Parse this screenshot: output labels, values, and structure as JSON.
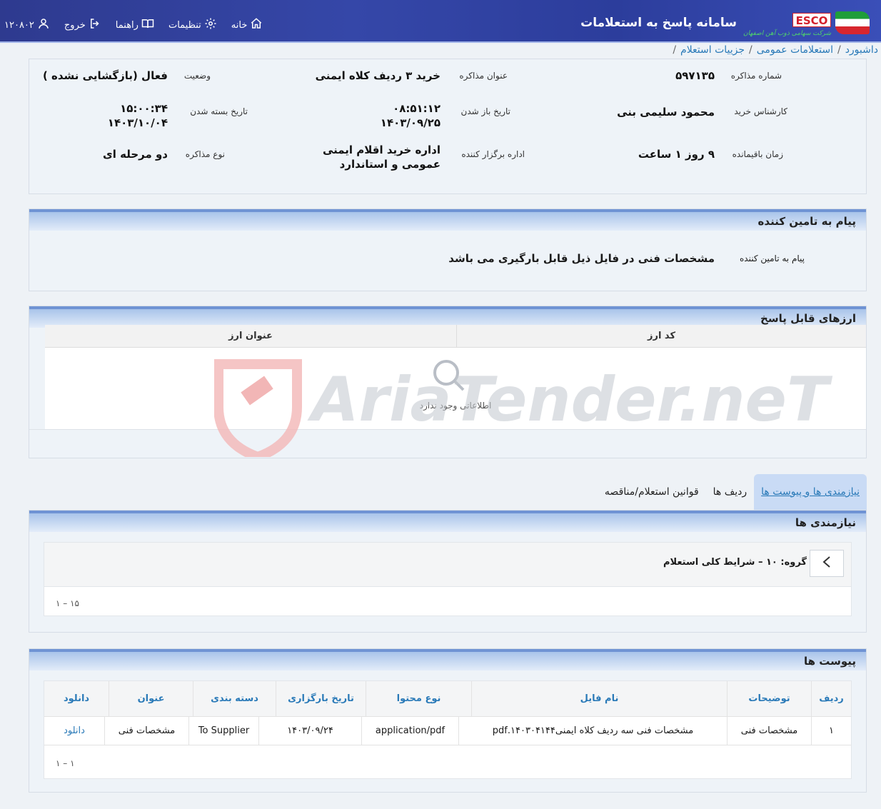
{
  "header": {
    "app_title": "سامانه پاسخ به استعلامات",
    "logo_text": "ESCO",
    "logo_sub": "شرکت سهامی ذوب آهن اصفهان",
    "nav": {
      "home": "خانه",
      "settings": "تنظیمات",
      "guide": "راهنما",
      "logout": "خروج",
      "user_id": "۱۲۰۸۰۲"
    }
  },
  "breadcrumb": [
    "داشبورد",
    "استعلامات عمومی",
    "جزییات استعلام"
  ],
  "info": {
    "negotiation_no_label": "شماره مذاکره",
    "negotiation_no": "۵۹۷۱۳۵",
    "title_label": "عنوان مذاکره",
    "title": "خرید ۳ ردیف کلاه ایمنی",
    "status_label": "وضعیت",
    "status": "فعال (بازگشایی نشده )",
    "buyer_label": "کارشناس خرید",
    "buyer": "محمود سلیمی بنی",
    "open_date_label": "تاریخ باز شدن",
    "open_time": "۰۸:۵۱:۱۲",
    "open_date": "۱۴۰۳/۰۹/۲۵",
    "close_date_label": "تاریخ بسته شدن",
    "close_time": "۱۵:۰۰:۳۴",
    "close_date": "۱۴۰۳/۱۰/۰۴",
    "remaining_label": "زمان باقیمانده",
    "remaining": "۹ روز ۱ ساعت",
    "organizer_label": "اداره برگزار کننده",
    "organizer_line1": "اداره خرید اقلام ایمنی",
    "organizer_line2": "عمومی و استاندارد",
    "type_label": "نوع مذاکره",
    "type": "دو مرحله ای"
  },
  "supplier_message": {
    "panel_title": "پیام به تامین کننده",
    "label": "پیام به تامین کننده",
    "text": "مشخصات فنی در فایل ذیل قابل بارگیری می باشد"
  },
  "currencies": {
    "panel_title": "ارزهای قابل پاسخ",
    "col_code": "کد ارز",
    "col_title": "عنوان ارز",
    "empty": "اطلاعاتی وجود ندارد"
  },
  "watermark_text": "AriaTender.neT",
  "tabs": [
    "نیازمندی ها و پیوست ها",
    "ردیف ها",
    "قوانین استعلام/مناقصه"
  ],
  "requirements": {
    "panel_title": "نیازمندی ها",
    "group_title": "گروه: ۱۰ – شرایط کلی استعلام",
    "pager": "۱ – ۱۵"
  },
  "attachments": {
    "panel_title": "پیوست ها",
    "columns": [
      "ردیف",
      "توضیحات",
      "نام فایل",
      "نوع محتوا",
      "تاریخ بارگزاری",
      "دسته بندی",
      "عنوان",
      "دانلود"
    ],
    "rows": [
      [
        "۱",
        "مشخصات فنی",
        "مشخصات فنی سه ردیف کلاه ایمنی۱۴۰۳۰۴۱۴۴.pdf",
        "application/pdf",
        "۱۴۰۳/۰۹/۲۴",
        "To Supplier",
        "مشخصات فنی",
        "دانلود"
      ]
    ],
    "pager": "۱ – ۱"
  },
  "colors": {
    "accent": "#2a7ab8",
    "topbar": "#3547a8",
    "panel_bar": "#6f93d4"
  }
}
